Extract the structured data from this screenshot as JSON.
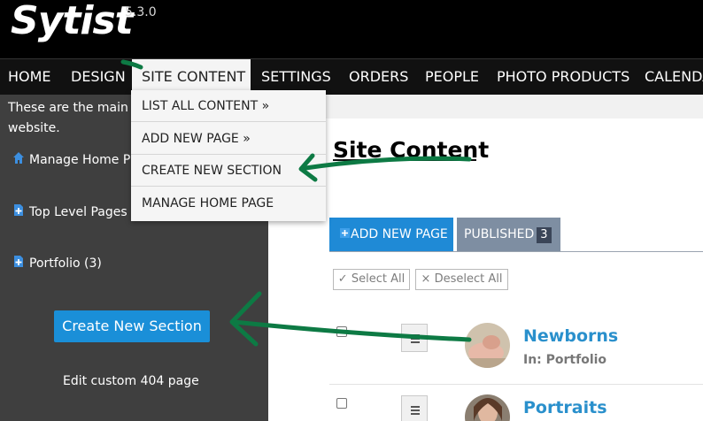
{
  "app": {
    "logo": "Sytist",
    "version": "5.3.0"
  },
  "nav": [
    {
      "label": "HOME"
    },
    {
      "label": "DESIGN"
    },
    {
      "label": "SITE CONTENT"
    },
    {
      "label": "SETTINGS"
    },
    {
      "label": "ORDERS"
    },
    {
      "label": "PEOPLE"
    },
    {
      "label": "PHOTO PRODUCTS"
    },
    {
      "label": "CALENDA"
    }
  ],
  "dropdown": [
    {
      "label": "LIST ALL CONTENT »"
    },
    {
      "label": "ADD NEW PAGE »"
    },
    {
      "label": "CREATE NEW SECTION"
    },
    {
      "label": "MANAGE HOME PAGE"
    }
  ],
  "sidebar": {
    "intro": "These are the main pages of your website.",
    "links": [
      {
        "label": "Manage Home P",
        "icon": "home-icon"
      },
      {
        "label": "Top Level Pages",
        "icon": "add-page-icon"
      },
      {
        "label": "Portfolio (3)",
        "icon": "add-page-icon"
      }
    ],
    "create_section": "Create New Section",
    "edit_404": "Edit custom 404 page"
  },
  "main": {
    "title": "Site Content",
    "tab_add": "ADD NEW PAGE",
    "tab_published": "PUBLISHED",
    "published_count": "3",
    "select_all": "Select All",
    "deselect_all": "Deselect All",
    "items": [
      {
        "title": "Newborns",
        "sub": "In: Portfolio"
      },
      {
        "title": "Portraits",
        "sub": ""
      }
    ]
  },
  "colors": {
    "accent": "#1a8fd8",
    "annotation_arrow": "#0d7a44",
    "link": "#2a90cc"
  }
}
